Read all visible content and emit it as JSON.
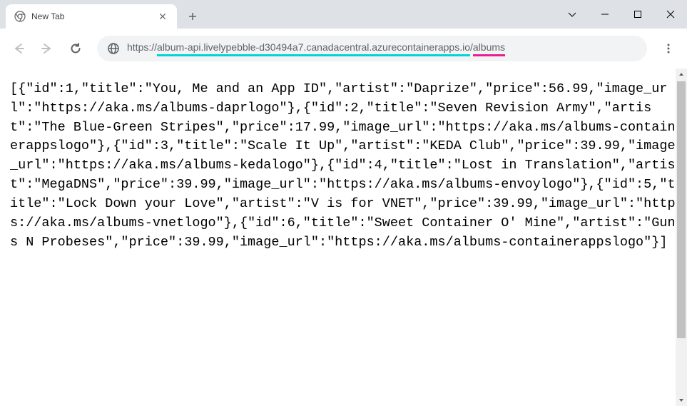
{
  "tab": {
    "title": "New Tab"
  },
  "url": {
    "scheme": "https://",
    "host": "album-api.livelypebble-d30494a7.canadacentral.azurecontainerapps.io",
    "slash": "/",
    "path": "albums"
  },
  "body": "[{\"id\":1,\"title\":\"You, Me and an App ID\",\"artist\":\"Daprize\",\"price\":56.99,\"image_url\":\"https://aka.ms/albums-daprlogo\"},{\"id\":2,\"title\":\"Seven Revision Army\",\"artist\":\"The Blue-Green Stripes\",\"price\":17.99,\"image_url\":\"https://aka.ms/albums-containerappslogo\"},{\"id\":3,\"title\":\"Scale It Up\",\"artist\":\"KEDA Club\",\"price\":39.99,\"image_url\":\"https://aka.ms/albums-kedalogo\"},{\"id\":4,\"title\":\"Lost in Translation\",\"artist\":\"MegaDNS\",\"price\":39.99,\"image_url\":\"https://aka.ms/albums-envoylogo\"},{\"id\":5,\"title\":\"Lock Down your Love\",\"artist\":\"V is for VNET\",\"price\":39.99,\"image_url\":\"https://aka.ms/albums-vnetlogo\"},{\"id\":6,\"title\":\"Sweet Container O' Mine\",\"artist\":\"Guns N Probeses\",\"price\":39.99,\"image_url\":\"https://aka.ms/albums-containerappslogo\"}]"
}
